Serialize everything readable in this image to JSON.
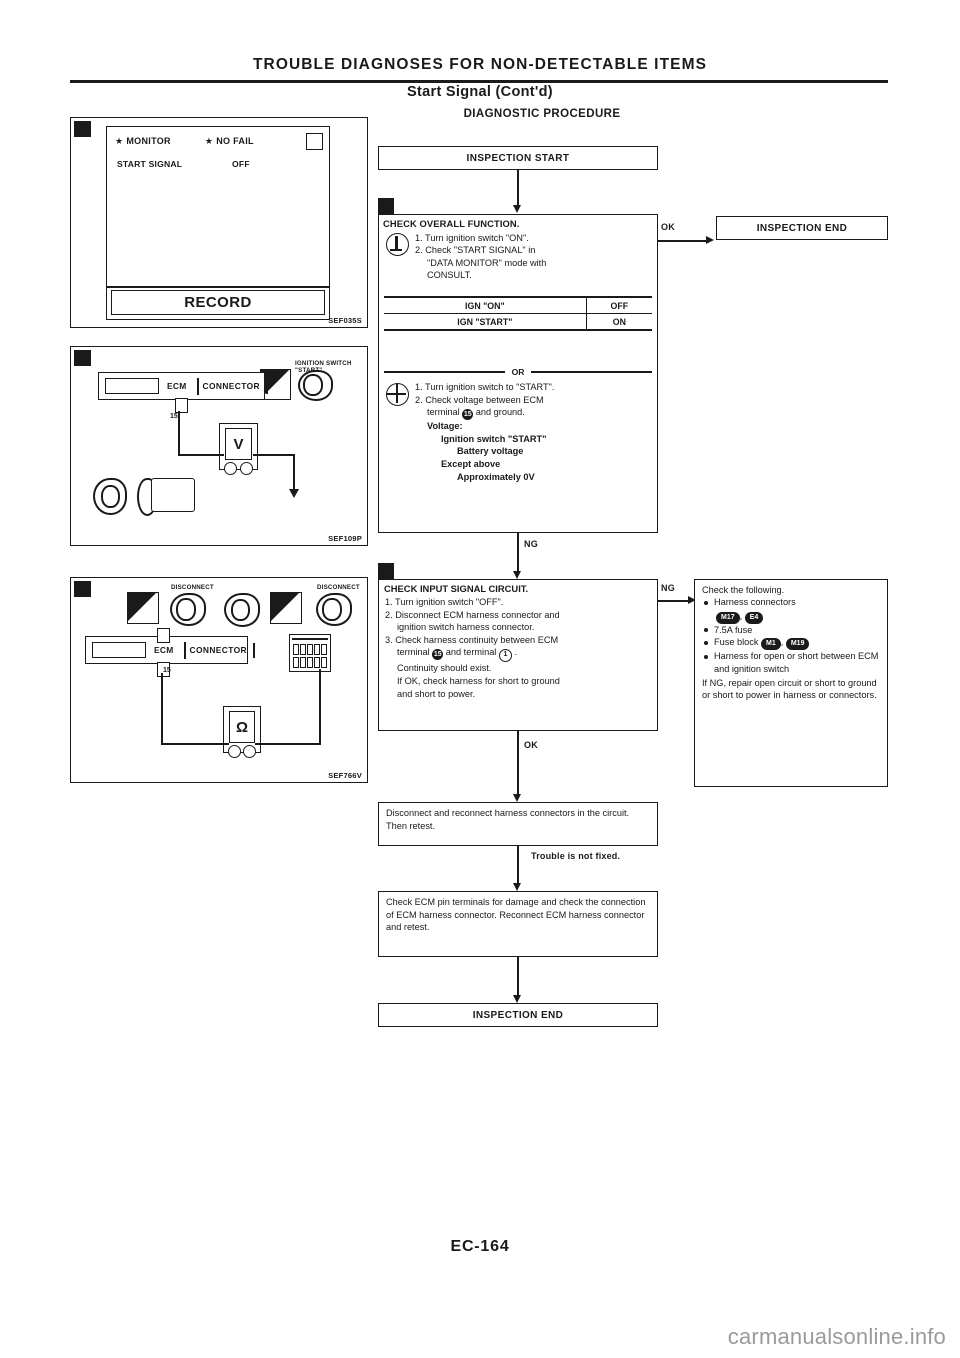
{
  "header": {
    "title": "TROUBLE DIAGNOSES FOR NON-DETECTABLE ITEMS",
    "subtitle": "Start Signal (Cont'd)",
    "procedure_heading": "DIAGNOSTIC PROCEDURE"
  },
  "illustrations": {
    "monitor": {
      "marker": "1",
      "star": "★",
      "monitor_label": "MONITOR",
      "nofail_label": "NO FAIL",
      "rows": [
        {
          "name": "START SIGNAL",
          "value": "OFF"
        }
      ],
      "record_label": "RECORD",
      "code": "SEF035S"
    },
    "wiring1": {
      "marker": "2",
      "connector_ecm": "ECM",
      "connector_word": "CONNECTOR",
      "pin_label": "15",
      "meter_label": "V",
      "caption": "IGNITION SWITCH \"START\"",
      "code": "SEF109P"
    },
    "wiring2": {
      "marker": "3",
      "connector_ecm": "ECM",
      "connector_word": "CONNECTOR",
      "pin_label": "15",
      "meter_label": "Ω",
      "caption_disconnect": "DISCONNECT",
      "code": "SEF766V"
    }
  },
  "flow": {
    "inspection_start": "INSPECTION START",
    "step1": {
      "marker": "2",
      "title": "CHECK OVERALL FUNCTION.",
      "lines": [
        "1. Turn ignition switch \"ON\".",
        "2. Check \"START SIGNAL\" in",
        "\"DATA MONITOR\" mode with",
        "CONSULT."
      ],
      "table": {
        "rows": [
          {
            "condition": "IGN \"ON\"",
            "result": "OFF"
          },
          {
            "condition": "IGN \"START\"",
            "result": "ON"
          }
        ]
      },
      "or_label": "OR",
      "alt_lines": [
        "1. Turn ignition switch to \"START\".",
        "2. Check voltage between ECM",
        "terminal ① and ground.",
        "Voltage:",
        "Ignition switch \"START\"",
        "Battery voltage",
        "Except above",
        "Approximately 0V"
      ],
      "alt_terminal": "15"
    },
    "inspection_end_top": "INSPECTION END",
    "ok_label": "OK",
    "ng_label_1": "NG",
    "step2": {
      "marker": "3",
      "title": "CHECK INPUT SIGNAL CIRCUIT.",
      "lines": [
        "1. Turn ignition switch \"OFF\".",
        "2. Disconnect ECM harness connector and",
        "ignition switch harness connector.",
        "3. Check harness continuity between ECM",
        "terminal ① and terminal ② .",
        "Continuity should exist.",
        "If OK, check harness for short to ground",
        "and short to power."
      ],
      "terminal_a": "15",
      "terminal_b": "1"
    },
    "ng_label_2": "NG",
    "ok_label_2": "OK",
    "check_following": {
      "title": "Check the following.",
      "bullets": [
        "Harness connectors",
        "7.5A fuse",
        "Fuse block",
        "Harness for open or short between ECM and ignition switch"
      ],
      "connector_badges_1": [
        "M17",
        "E4"
      ],
      "connector_badges_2": [
        "M1",
        "M19"
      ],
      "footer": "If NG, repair open circuit or short to ground or short to power in harness or connectors."
    },
    "step_disconnect": "Disconnect and reconnect harness connectors in the circuit. Then retest.",
    "trouble_not_fixed": "Trouble is not fixed.",
    "step_pin_check": "Check ECM pin terminals for damage and check the connection of ECM harness connector. Reconnect ECM harness connector and retest.",
    "inspection_end_bottom": "INSPECTION END"
  },
  "footer": {
    "page_number": "EC-164",
    "watermark": "carmanualsonline.info"
  }
}
